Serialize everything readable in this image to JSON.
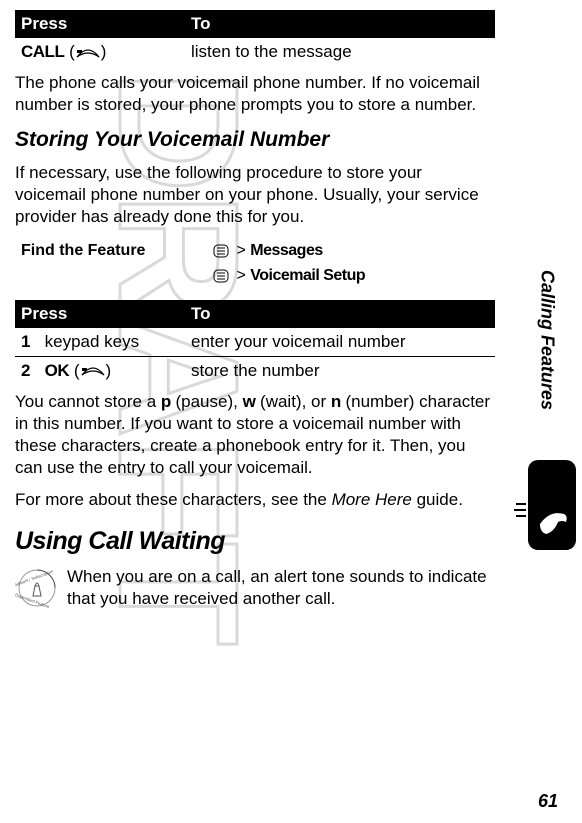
{
  "tables": {
    "t1": {
      "h1": "Press",
      "h2": "To",
      "r1c1a": "CALL",
      "r1c1b": "(      )",
      "r1c2": "listen to the message"
    },
    "t2": {
      "h1": "Press",
      "h2": "To",
      "r1n": "1",
      "r1c1": "keypad keys",
      "r1c2": "enter your voicemail number",
      "r2n": "2",
      "r2c1a": "OK",
      "r2c1b": "(      )",
      "r2c2": "store the number"
    }
  },
  "para1": "The phone calls your voicemail phone number. If no voicemail number is stored, your phone prompts you to store a number.",
  "h_storing": "Storing Your Voicemail Number",
  "para2": "If necessary, use the following procedure to store your voicemail phone number on your phone. Usually, your service provider has already done this for you.",
  "find": {
    "label": "Find the Feature",
    "gt": ">",
    "m1": "Messages",
    "m2": "Voicemail Setup"
  },
  "para3a": "You cannot store a ",
  "para3p": "p",
  "para3b": " (pause), ",
  "para3w": "w",
  "para3c": " (wait), or ",
  "para3n": "n",
  "para3d": " (number) character in this number. If you want to store a voicemail number with these characters, create a phonebook entry for it. Then, you can use the entry to call your voicemail.",
  "para4a": "For more about these characters, see the ",
  "para4i": "More Here",
  "para4b": " guide.",
  "h_cw": "Using Call Waiting",
  "para5": "When you are on a call, an alert tone sounds to indicate that you have received another call.",
  "sidetab": "Calling Features",
  "pagenum": "61"
}
